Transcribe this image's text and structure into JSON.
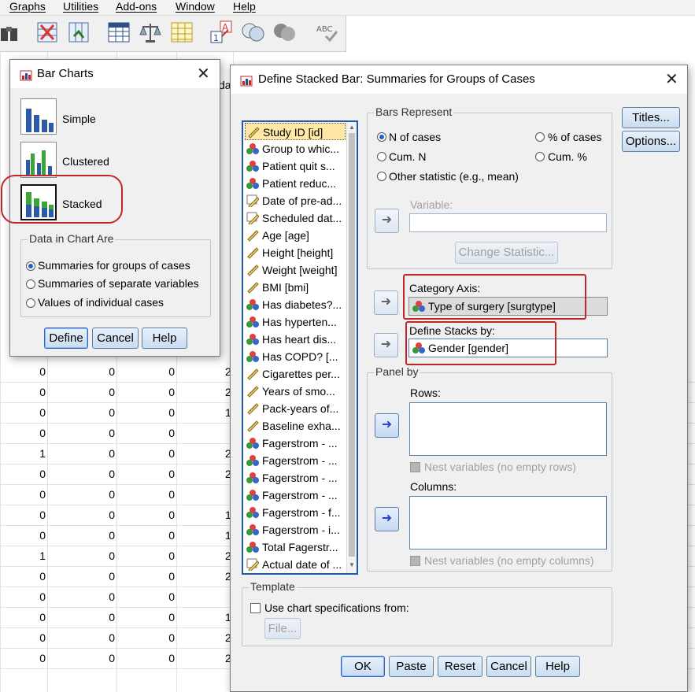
{
  "menu": [
    "Graphs",
    "Utilities",
    "Add-ons",
    "Window",
    "Help"
  ],
  "grid": {
    "rows": [
      [
        "0",
        "0",
        "0"
      ],
      [
        "0",
        "0",
        "0"
      ],
      [
        "0",
        "0",
        "0"
      ],
      [
        "0",
        "0",
        "0"
      ],
      [
        "1",
        "0",
        "0"
      ],
      [
        "0",
        "0",
        "0"
      ],
      [
        "0",
        "0",
        "0"
      ],
      [
        "0",
        "0",
        "0"
      ],
      [
        "0",
        "0",
        "0"
      ],
      [
        "1",
        "0",
        "0"
      ],
      [
        "0",
        "0",
        "0"
      ],
      [
        "0",
        "0",
        "0"
      ],
      [
        "0",
        "0",
        "0"
      ],
      [
        "0",
        "0",
        "0"
      ],
      [
        "0",
        "0",
        "0"
      ]
    ],
    "partial_col": [
      "2",
      "2",
      "1",
      "",
      "2",
      "2",
      "",
      "1",
      "1",
      "2",
      "2",
      "",
      "1",
      "2",
      "2"
    ],
    "header_partial": "da"
  },
  "bar_charts": {
    "title": "Bar Charts",
    "types": [
      "Simple",
      "Clustered",
      "Stacked"
    ],
    "group_title": "Data in Chart Are",
    "options": [
      "Summaries for groups of cases",
      "Summaries of separate variables",
      "Values of individual cases"
    ],
    "buttons": {
      "define": "Define",
      "cancel": "Cancel",
      "help": "Help"
    }
  },
  "define": {
    "title": "Define Stacked Bar: Summaries for Groups of Cases",
    "variables": [
      {
        "label": "Study ID [id]",
        "type": "scale"
      },
      {
        "label": "Group to whic...",
        "type": "nominal"
      },
      {
        "label": "Patient quit s...",
        "type": "nominal"
      },
      {
        "label": "Patient reduc...",
        "type": "nominal"
      },
      {
        "label": "Date of pre-ad...",
        "type": "scale-date"
      },
      {
        "label": "Scheduled dat...",
        "type": "scale-date"
      },
      {
        "label": "Age [age]",
        "type": "scale"
      },
      {
        "label": "Height [height]",
        "type": "scale"
      },
      {
        "label": "Weight [weight]",
        "type": "scale"
      },
      {
        "label": "BMI [bmi]",
        "type": "scale"
      },
      {
        "label": "Has diabetes?...",
        "type": "nominal"
      },
      {
        "label": "Has hyperten...",
        "type": "nominal"
      },
      {
        "label": "Has heart dis...",
        "type": "nominal"
      },
      {
        "label": "Has COPD? [...",
        "type": "nominal"
      },
      {
        "label": "Cigarettes per...",
        "type": "scale"
      },
      {
        "label": "Years of smo...",
        "type": "scale"
      },
      {
        "label": "Pack-years of...",
        "type": "scale"
      },
      {
        "label": "Baseline exha...",
        "type": "scale"
      },
      {
        "label": "Fagerstrom - ...",
        "type": "nominal"
      },
      {
        "label": "Fagerstrom - ...",
        "type": "nominal"
      },
      {
        "label": "Fagerstrom - ...",
        "type": "nominal"
      },
      {
        "label": "Fagerstrom - ...",
        "type": "nominal"
      },
      {
        "label": "Fagerstrom - f...",
        "type": "nominal"
      },
      {
        "label": "Fagerstrom - i...",
        "type": "nominal"
      },
      {
        "label": "Total Fagerstr...",
        "type": "nominal"
      },
      {
        "label": "Actual date of ...",
        "type": "scale-date"
      }
    ],
    "bars_represent": {
      "title": "Bars Represent",
      "n_cases": "N of cases",
      "pct_cases": "% of cases",
      "cum_n": "Cum. N",
      "cum_pct": "Cum. %",
      "other": "Other statistic (e.g., mean)",
      "variable_label": "Variable:",
      "change_stat": "Change Statistic..."
    },
    "category_axis": {
      "label": "Category Axis:",
      "value": "Type of surgery [surgtype]"
    },
    "define_stacks": {
      "label": "Define Stacks by:",
      "value": "Gender [gender]"
    },
    "panel_by": {
      "title": "Panel by",
      "rows": "Rows:",
      "nest_rows": "Nest variables (no empty rows)",
      "columns": "Columns:",
      "nest_cols": "Nest variables (no empty columns)"
    },
    "template": {
      "title": "Template",
      "use": "Use chart specifications from:",
      "file": "File..."
    },
    "side_buttons": {
      "titles": "Titles...",
      "options": "Options..."
    },
    "buttons": {
      "ok": "OK",
      "paste": "Paste",
      "reset": "Reset",
      "cancel": "Cancel",
      "help": "Help"
    }
  }
}
